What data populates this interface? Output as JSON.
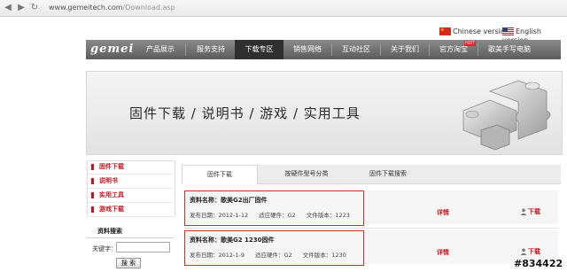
{
  "browser": {
    "url_host": "www.gemeitech.com",
    "url_path": "/Download.asp"
  },
  "language": {
    "chinese": "Chinese version",
    "english": "English version"
  },
  "nav": {
    "logo": "gemei",
    "items": [
      "产品展示",
      "服务支持",
      "下载专区",
      "销售网络",
      "互动社区",
      "关于我们",
      "官方淘宝",
      "歌美手写电脑"
    ],
    "active_index": 2,
    "hot_badge": "HOT"
  },
  "banner": {
    "text": "固件下载 / 说明书 / 游戏 / 实用工具"
  },
  "sidebar": {
    "items": [
      "固件下载",
      "说明书",
      "实用工具",
      "游戏下载"
    ],
    "search_title": "资料搜索",
    "keyword_label": "关键字：",
    "keyword_value": "",
    "search_button": "搜 索"
  },
  "tabs": [
    "固件下载",
    "按硬件型号分类",
    "固件下载搜索"
  ],
  "records": [
    {
      "title": "资料名称：歌美G2出厂固件",
      "date": "发布日期：2012-1-12",
      "hardware": "适应硬件：G2",
      "version": "文件版本：1223",
      "detail": "详情",
      "download": "下载"
    },
    {
      "title": "资料名称：歌美G2  1230固件",
      "date": "发布日期：2012-1-9",
      "hardware": "适应硬件：G2",
      "version": "文件版本：1230",
      "detail": "详情",
      "download": "下载"
    }
  ],
  "watermark": "#834422"
}
